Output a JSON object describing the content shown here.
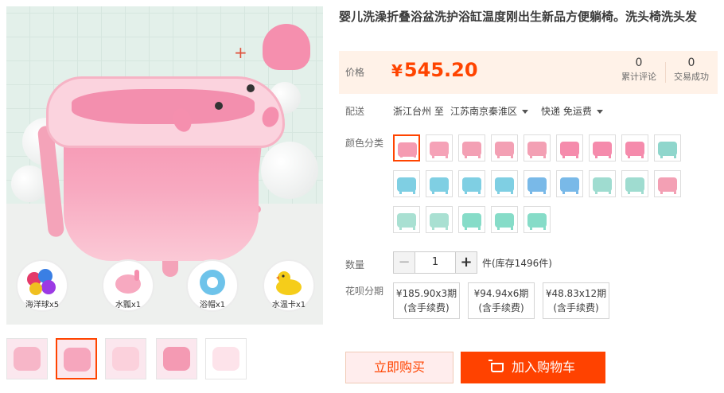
{
  "product": {
    "title": "婴儿洗澡折叠浴盆洗护浴缸温度刚出生新品方便躺椅。洗头椅洗头发",
    "price_label": "价格",
    "currency": "¥",
    "price": "545.20",
    "stats": [
      {
        "num": "0",
        "label": "累计评论"
      },
      {
        "num": "0",
        "label": "交易成功"
      }
    ]
  },
  "shipping": {
    "label": "配送",
    "from": "浙江台州 至",
    "to": "江苏南京秦淮区",
    "method": "快递 免运费"
  },
  "color": {
    "label": "颜色分类",
    "selected_index": 0,
    "swatches": [
      {
        "color": "#f59bb2",
        "icon": "pink-tub"
      },
      {
        "color": "#f5a2b7",
        "icon": "pink-tub"
      },
      {
        "color": "#f3a0b4",
        "icon": "pink-tub"
      },
      {
        "color": "#f3a0b4",
        "icon": "pink-tub"
      },
      {
        "color": "#f3a0b4",
        "icon": "pink-tub"
      },
      {
        "color": "#f58bac",
        "icon": "pink-tub"
      },
      {
        "color": "#f58bac",
        "icon": "pink-tub"
      },
      {
        "color": "#f58bac",
        "icon": "pink-tub"
      },
      {
        "color": "#8fd6cc",
        "icon": "green-tub"
      },
      {
        "color": "#7fcfe3",
        "icon": "blue-tub"
      },
      {
        "color": "#7fcfe3",
        "icon": "blue-tub"
      },
      {
        "color": "#7fcfe3",
        "icon": "blue-tub"
      },
      {
        "color": "#7fcfe3",
        "icon": "blue-tub"
      },
      {
        "color": "#79b9e8",
        "icon": "blue-tub"
      },
      {
        "color": "#79b9e8",
        "icon": "blue-tub"
      },
      {
        "color": "#9fdcd0",
        "icon": "green-tub"
      },
      {
        "color": "#9fdcd0",
        "icon": "green-tub"
      },
      {
        "color": "#f3a0b4",
        "icon": "pink-tub"
      },
      {
        "color": "#a9e0d2",
        "icon": "green-tub"
      },
      {
        "color": "#a9e0d2",
        "icon": "green-tub"
      },
      {
        "color": "#86dcc8",
        "icon": "green-tub"
      },
      {
        "color": "#86dcc8",
        "icon": "green-tub"
      },
      {
        "color": "#86dcc8",
        "icon": "green-tub"
      }
    ]
  },
  "quantity": {
    "label": "数量",
    "minus": "−",
    "value": "1",
    "plus": "+",
    "stock": "件(库存1496件)"
  },
  "installment": {
    "label": "花呗分期",
    "options": [
      {
        "line1": "¥185.90x3期",
        "line2": "(含手续费)"
      },
      {
        "line1": "¥94.94x6期",
        "line2": "(含手续费)"
      },
      {
        "line1": "¥48.83x12期",
        "line2": "(含手续费)"
      }
    ]
  },
  "actions": {
    "buy_now": "立即购买",
    "add_to_cart": "加入购物车"
  },
  "gallery": {
    "accessories": [
      {
        "label": "海洋球x5"
      },
      {
        "label": "水瓢x1"
      },
      {
        "label": "浴帽x1"
      },
      {
        "label": "水温卡x1"
      }
    ],
    "thumbnails": 5,
    "active_thumbnail": 1
  },
  "colors": {
    "accent": "#ff4400",
    "price_bg": "#fff2e8"
  }
}
